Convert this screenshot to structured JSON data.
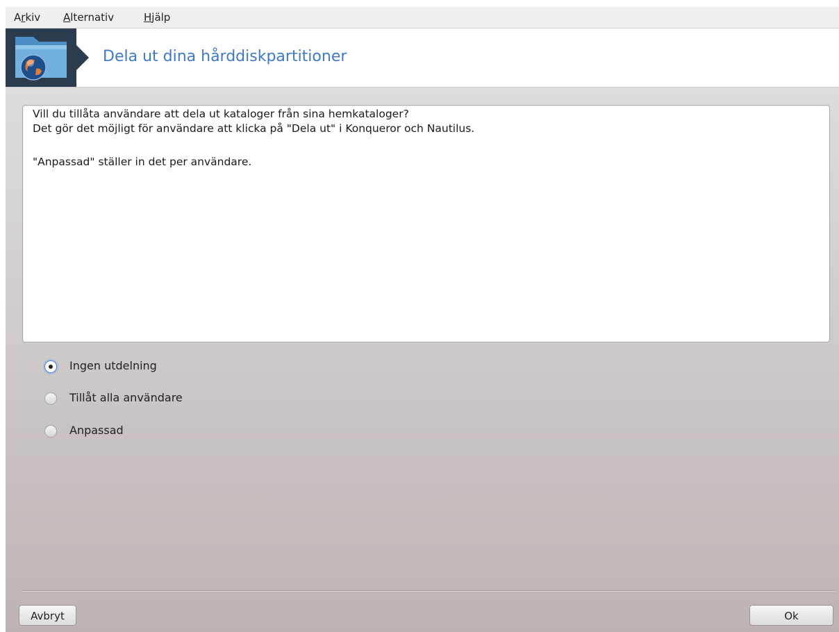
{
  "menubar": {
    "items": [
      {
        "pre": "A",
        "ul": "r",
        "post": "kiv"
      },
      {
        "pre": "",
        "ul": "A",
        "post": "lternativ"
      },
      {
        "pre": "",
        "ul": "H",
        "post": "jälp"
      }
    ]
  },
  "header": {
    "title": "Dela ut dina hårddiskpartitioner",
    "icon": "folder-globe-icon"
  },
  "description": {
    "line1": "Vill du tillåta användare att dela ut kataloger från sina hemkataloger?",
    "line2": "Det gör det möjligt för användare att klicka på \"Dela ut\" i Konqueror och Nautilus.",
    "line3": "\"Anpassad\" ställer in det per användare."
  },
  "options": [
    {
      "label": "Ingen utdelning",
      "selected": true
    },
    {
      "label": "Tillåt alla användare",
      "selected": false
    },
    {
      "label": "Anpassad",
      "selected": false
    }
  ],
  "buttons": {
    "cancel": "Avbryt",
    "ok": "Ok"
  }
}
